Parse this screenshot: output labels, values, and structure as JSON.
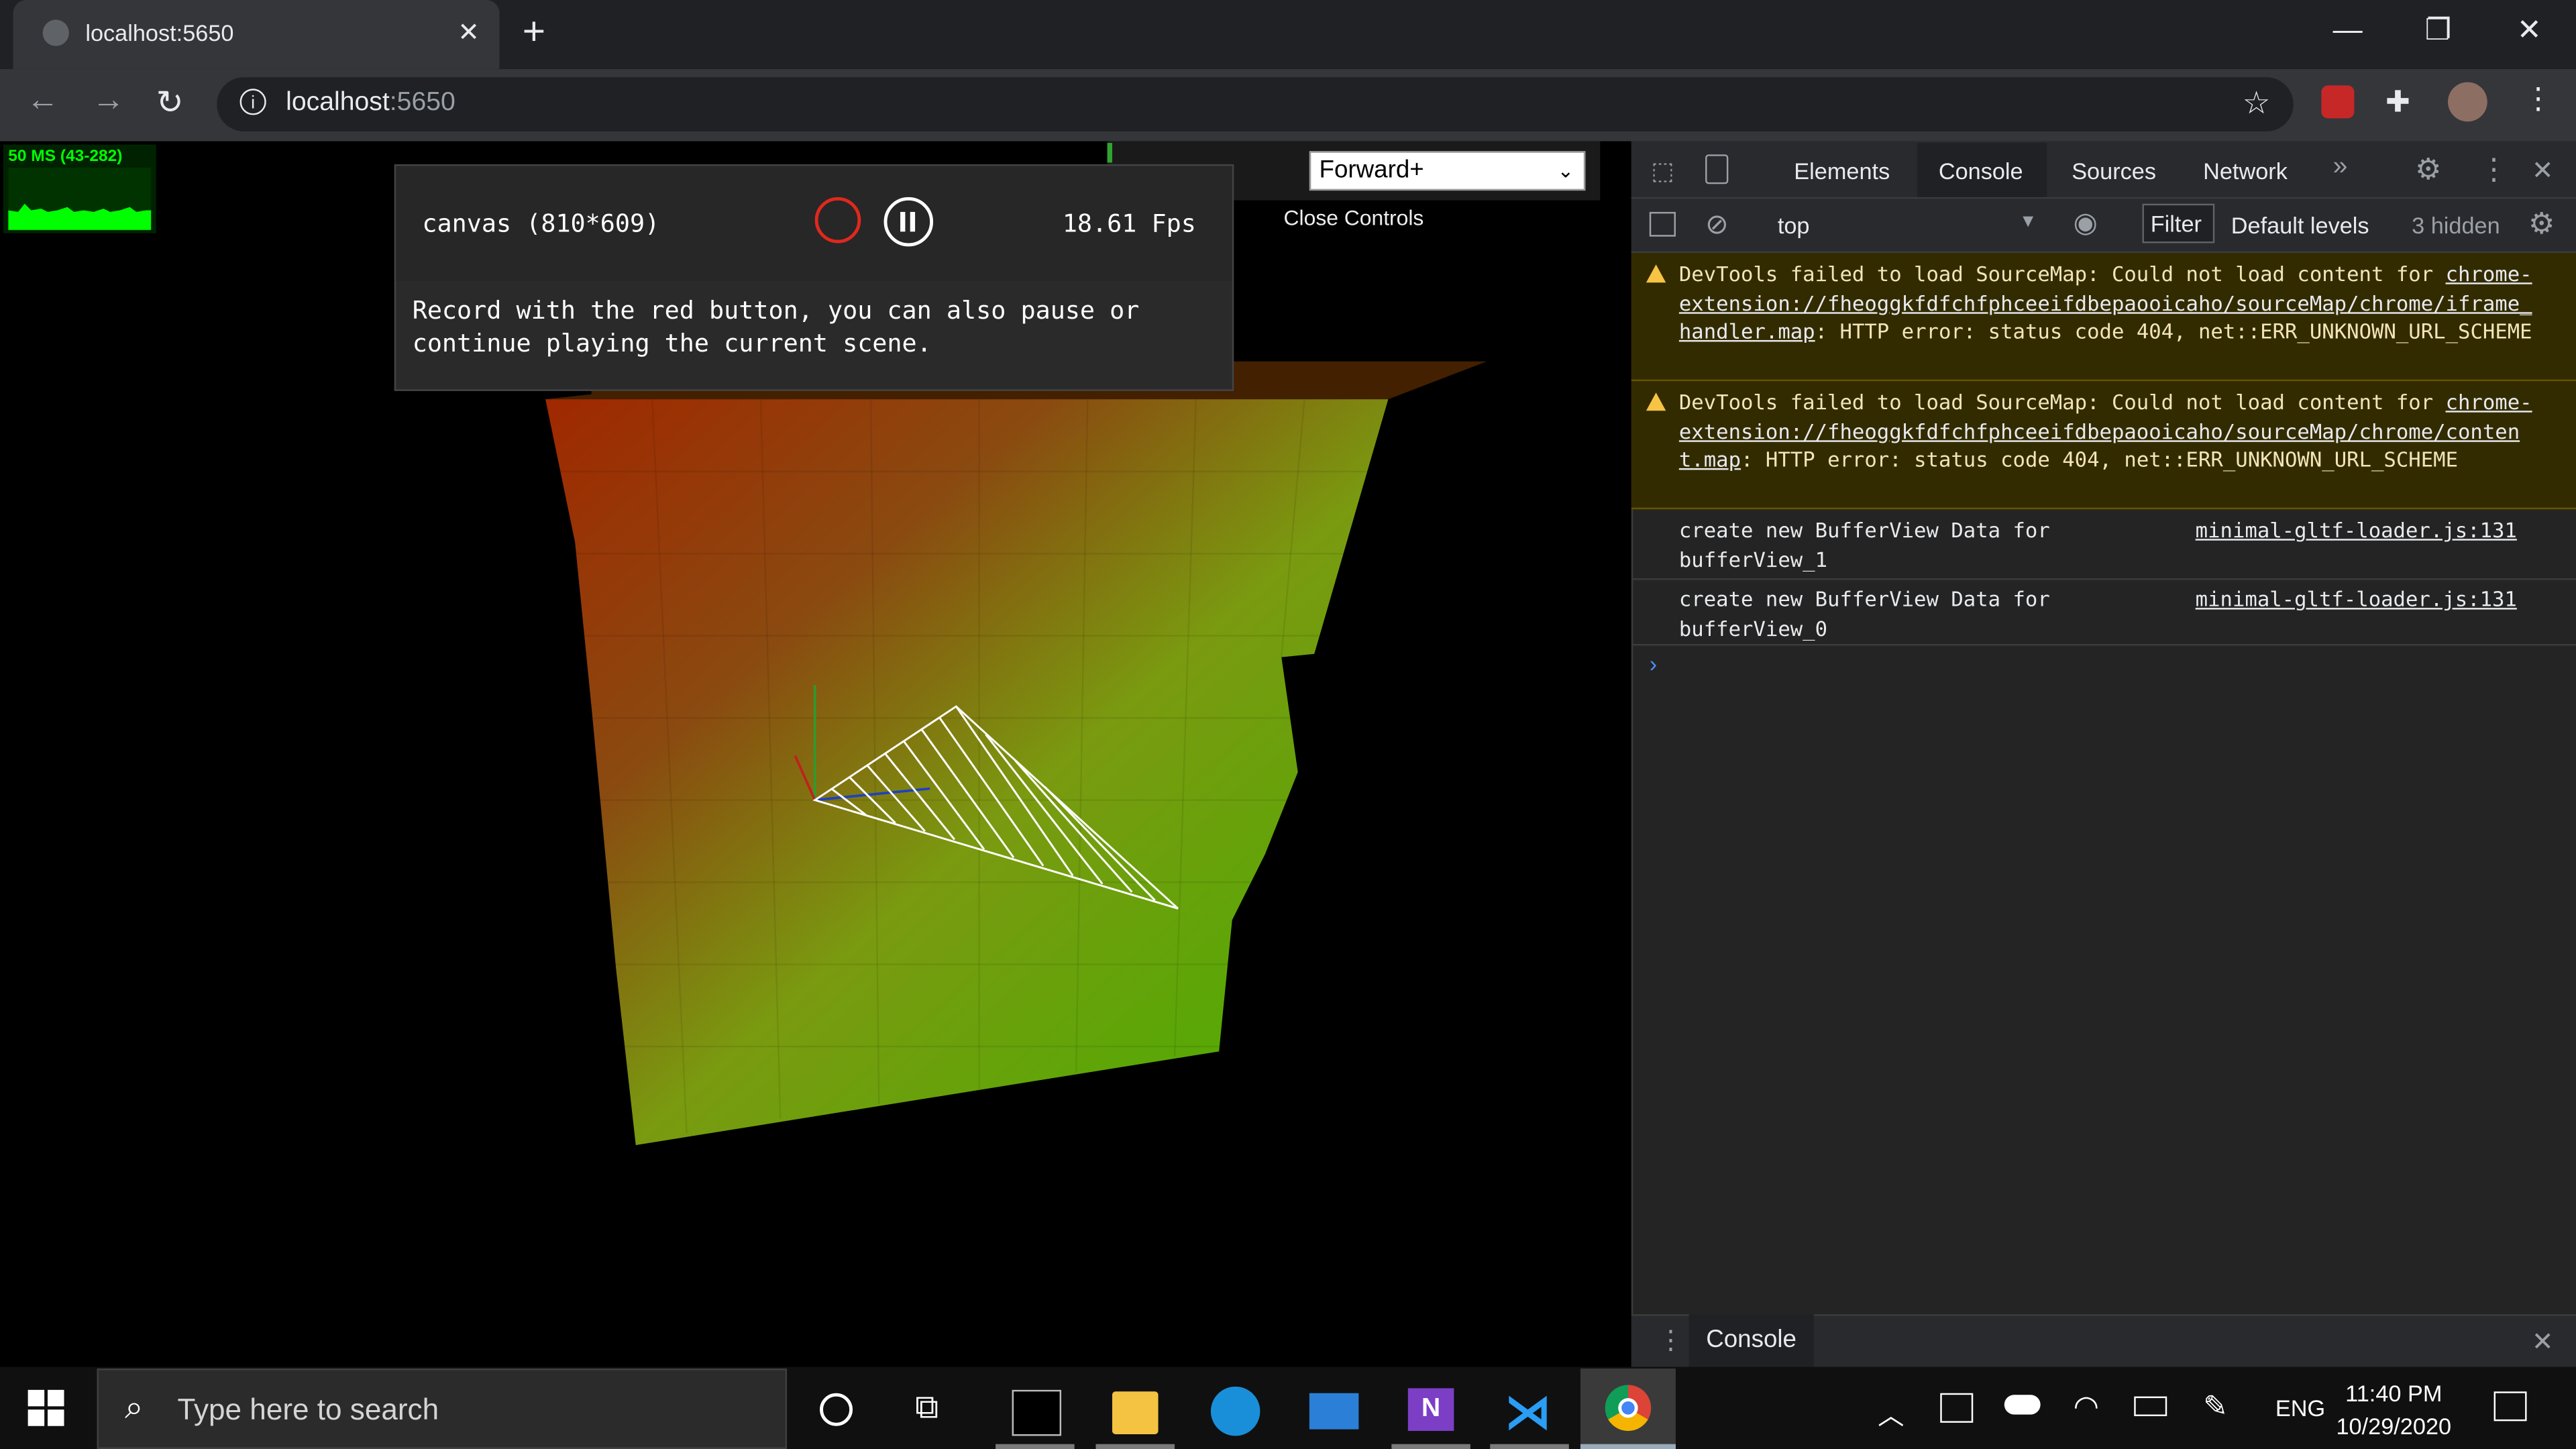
{
  "browser": {
    "tab_title": "localhost:5650",
    "url_host": "localhost",
    "url_port": ":5650"
  },
  "page": {
    "stats_label": "50 MS (43-282)",
    "render_mode": "Forward+",
    "close_controls": "Close Controls",
    "recorder": {
      "canvas_label": "canvas (810*609)",
      "fps": "18.61 Fps",
      "help_text": "Record with the red button, you can also pause or continue playing the current scene."
    }
  },
  "devtools": {
    "tabs": [
      "Elements",
      "Console",
      "Sources",
      "Network"
    ],
    "active_tab": "Console",
    "context": "top",
    "filter_label": "Filter",
    "levels": "Default levels",
    "hidden": "3 hidden",
    "messages": [
      {
        "type": "warning",
        "pre": "DevTools failed to load SourceMap: Could not load content for ",
        "link": "chrome-extension://fheoggkfdfchfphceeifdbepaooicaho/sourceMap/chrome/iframe_handler.map",
        "post": ": HTTP error: status code 404, net::ERR_UNKNOWN_URL_SCHEME"
      },
      {
        "type": "warning",
        "pre": "DevTools failed to load SourceMap: Could not load content for ",
        "link": "chrome-extension://fheoggkfdfchfphceeifdbepaooicaho/sourceMap/chrome/content.map",
        "post": ": HTTP error: status code 404, net::ERR_UNKNOWN_URL_SCHEME"
      },
      {
        "type": "log",
        "text": "create new BufferView Data for bufferView_1",
        "source": "minimal-gltf-loader.js:131"
      },
      {
        "type": "log",
        "text": "create new BufferView Data for bufferView_0",
        "source": "minimal-gltf-loader.js:131"
      }
    ],
    "prompt": "›",
    "drawer_tab": "Console"
  },
  "taskbar": {
    "search_placeholder": "Type here to search",
    "language": "ENG",
    "time": "11:40 PM",
    "date": "10/29/2020"
  },
  "colors": {
    "record": "#e0281d",
    "stats_green": "#00ff00",
    "warning_bg": "#332b00"
  }
}
